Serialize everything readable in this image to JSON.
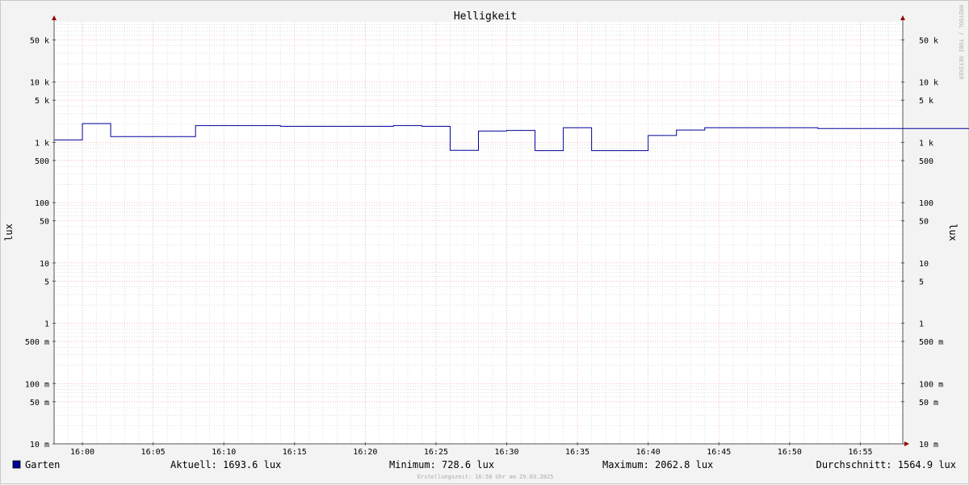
{
  "chart_data": {
    "type": "line",
    "title": "Helligkeit",
    "ylabel": "lux",
    "ylabel_right": "lux",
    "y_scale": "log",
    "ylim": [
      0.01,
      100000
    ],
    "y_ticks": [
      {
        "value": 50000,
        "label": "50 k"
      },
      {
        "value": 10000,
        "label": "10 k"
      },
      {
        "value": 5000,
        "label": "5 k"
      },
      {
        "value": 1000,
        "label": "1 k"
      },
      {
        "value": 500,
        "label": "500"
      },
      {
        "value": 100,
        "label": "100"
      },
      {
        "value": 50,
        "label": "50"
      },
      {
        "value": 10,
        "label": "10"
      },
      {
        "value": 5,
        "label": "5"
      },
      {
        "value": 1,
        "label": "1"
      },
      {
        "value": 0.5,
        "label": "500 m"
      },
      {
        "value": 0.1,
        "label": "100 m"
      },
      {
        "value": 0.05,
        "label": "50 m"
      },
      {
        "value": 0.01,
        "label": "10 m"
      }
    ],
    "xlim": [
      "15:58",
      "17:58"
    ],
    "x_ticks": [
      "16:00",
      "16:05",
      "16:10",
      "16:15",
      "16:20",
      "16:25",
      "16:30",
      "16:35",
      "16:40",
      "16:45",
      "16:50",
      "16:55"
    ],
    "grid": true,
    "series": [
      {
        "name": "Garten",
        "color": "#000099",
        "step": true,
        "points": [
          {
            "x": "15:58",
            "y": 1100
          },
          {
            "x": "16:00",
            "y": 2050
          },
          {
            "x": "16:02",
            "y": 1250
          },
          {
            "x": "16:08",
            "y": 1900
          },
          {
            "x": "16:14",
            "y": 1850
          },
          {
            "x": "16:22",
            "y": 1900
          },
          {
            "x": "16:24",
            "y": 1850
          },
          {
            "x": "16:26",
            "y": 740
          },
          {
            "x": "16:28",
            "y": 1540
          },
          {
            "x": "16:30",
            "y": 1580
          },
          {
            "x": "16:32",
            "y": 730
          },
          {
            "x": "16:34",
            "y": 1750
          },
          {
            "x": "16:36",
            "y": 730
          },
          {
            "x": "16:40",
            "y": 1300
          },
          {
            "x": "16:42",
            "y": 1600
          },
          {
            "x": "16:44",
            "y": 1750
          },
          {
            "x": "16:52",
            "y": 1700
          },
          {
            "x": "17:58",
            "y": 1700
          }
        ]
      }
    ]
  },
  "legend": {
    "series_name": "Garten",
    "swatch_color": "#000099",
    "current": "Aktuell: 1693.6 lux",
    "minimum": "Minimum: 728.6 lux",
    "maximum": "Maximum: 2062.8 lux",
    "average": "Durchschnitt: 1564.9 lux"
  },
  "footer": {
    "credit": "Erstellungszeit: 16:58 Uhr am 29.03.2025"
  },
  "watermark": "RRDTOOL / TOBI OETIKER",
  "colors": {
    "background": "#f3f3f3",
    "plot_area": "#ffffff",
    "grid_major": "#ff9999",
    "grid_minor": "#cccccc",
    "axis": "#555555",
    "arrow": "#990000"
  }
}
